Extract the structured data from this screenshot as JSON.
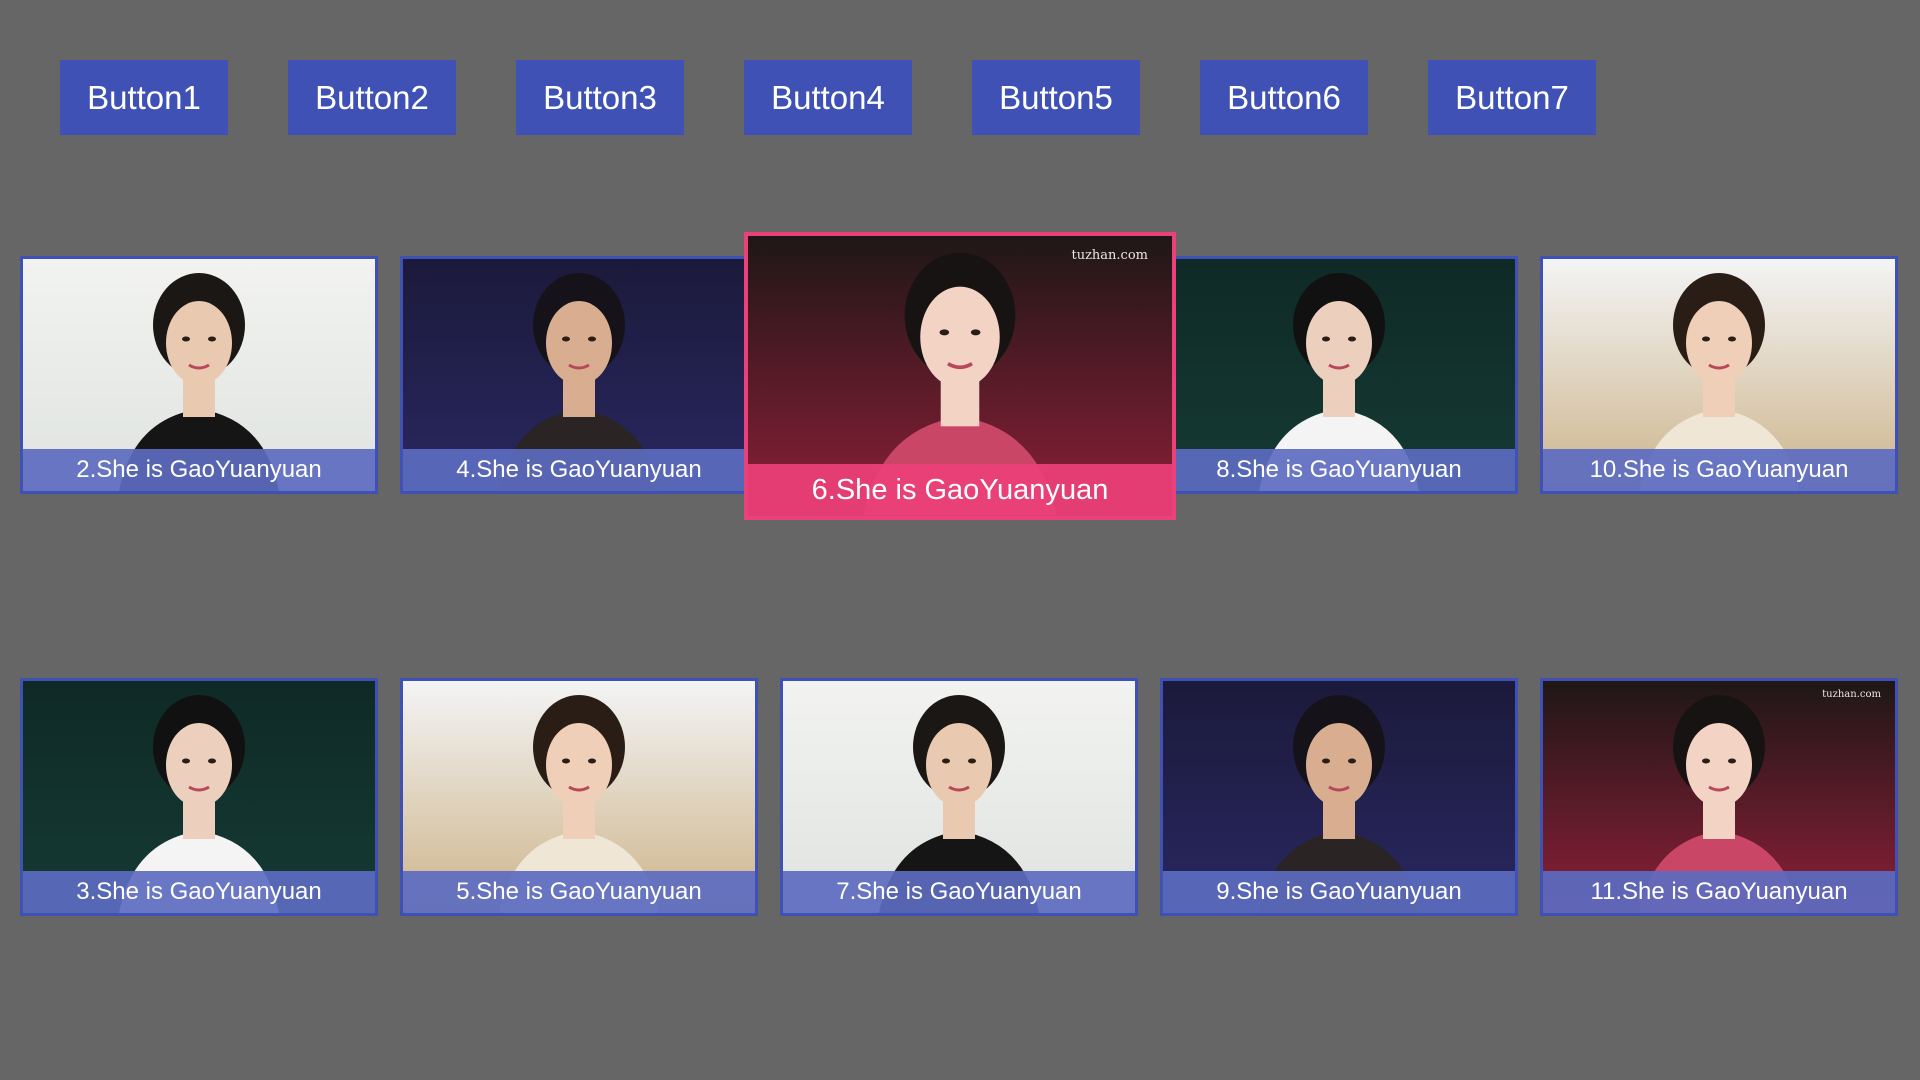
{
  "buttons": [
    {
      "label": "Button1"
    },
    {
      "label": "Button2"
    },
    {
      "label": "Button3"
    },
    {
      "label": "Button4"
    },
    {
      "label": "Button5"
    },
    {
      "label": "Button6"
    },
    {
      "label": "Button7"
    }
  ],
  "cards": [
    {
      "caption": "2.She is GaoYuanyuan",
      "scene": "light"
    },
    {
      "caption": "4.She is GaoYuanyuan",
      "scene": "navy"
    },
    {
      "caption": "6.She is GaoYuanyuan",
      "scene": "red",
      "watermark": "tuzhan.com",
      "focused": true
    },
    {
      "caption": "8.She is GaoYuanyuan",
      "scene": "teal"
    },
    {
      "caption": "10.She is GaoYuanyuan",
      "scene": "field"
    },
    {
      "caption": "3.She is GaoYuanyuan",
      "scene": "teal"
    },
    {
      "caption": "5.She is GaoYuanyuan",
      "scene": "field"
    },
    {
      "caption": "7.She is GaoYuanyuan",
      "scene": "light"
    },
    {
      "caption": "9.She is GaoYuanyuan",
      "scene": "navy"
    },
    {
      "caption": "11.She is GaoYuanyuan",
      "scene": "red",
      "watermark": "tuzhan.com"
    }
  ],
  "colors": {
    "background": "#666666",
    "button": "#3f51b5",
    "card_border": "#3f51b5",
    "caption_bg": "#5c6bc0",
    "focus_border": "#ec407a",
    "focus_caption_bg": "#ec407a"
  }
}
